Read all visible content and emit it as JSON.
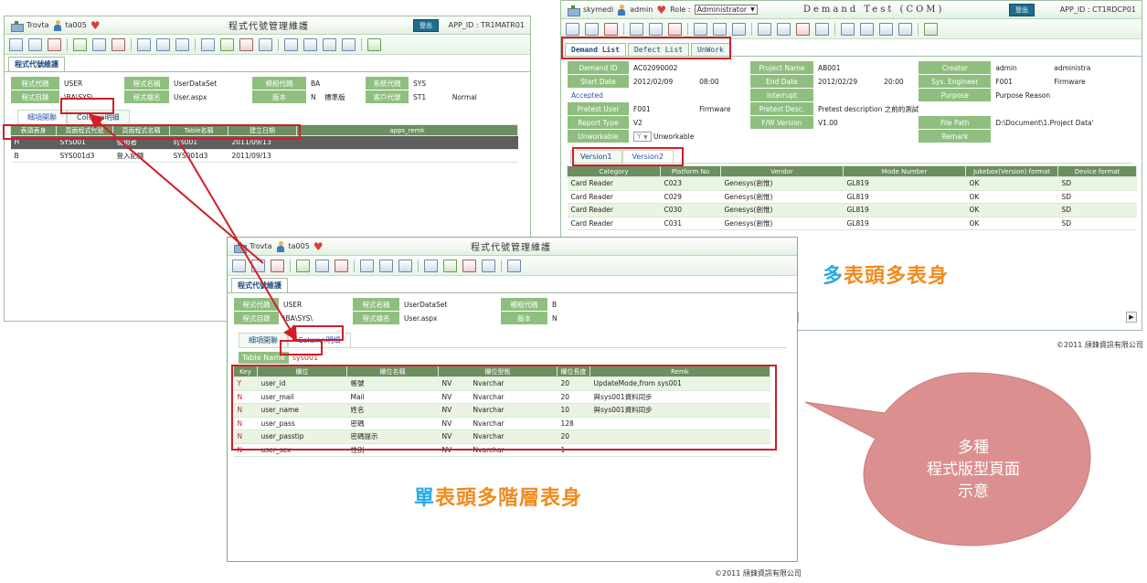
{
  "left_win": {
    "user": "Trovta",
    "user2": "ta005",
    "title": "程式代號管理維護",
    "logout_label": "登出",
    "app_id": "APP_ID : TR1MATR01",
    "tab_label": "程式代號維護",
    "form": {
      "row1": [
        "程式代碼",
        "USER",
        "程式名稱",
        "UserDataSet",
        "模組代碼",
        "BA",
        "系統代碼",
        "SYS"
      ],
      "row2": [
        "程式目錄",
        "\\BA\\SYS\\",
        "程式檔名",
        "User.aspx",
        "版本",
        "N",
        "標準版",
        "客戶代號",
        "ST1",
        "Normal"
      ]
    },
    "subtabs": [
      "細項開聯",
      "Column明細"
    ],
    "grid_headers": [
      "表頭表身",
      "頁面程式代號",
      "頁面程式名稱",
      "Table名稱",
      "建立日期",
      "apps_remk"
    ],
    "grid_rows": [
      [
        "H",
        "SYS001",
        "使用者",
        "sys001",
        "2011/09/13",
        ""
      ],
      [
        "B",
        "SYS001d3",
        "登入記錄",
        "SYS001d3",
        "2011/09/13",
        ""
      ]
    ]
  },
  "right_win": {
    "user": "skymedi",
    "user2": "admin",
    "role_label": "Role :",
    "role_value": "Administrator",
    "title": "Demand Test (COM)",
    "logout_label": "登出",
    "app_id": "APP_ID : CT1RDCP01",
    "tabs": [
      "Demand List",
      "Defect List",
      "UnWork"
    ],
    "form": {
      "r1": [
        "Demand ID",
        "AC02090002",
        "Project Name",
        "AB001",
        "Creator",
        "admin",
        "administra"
      ],
      "r2": [
        "Start Date",
        "2012/02/09",
        "08:00",
        "End Date",
        "2012/02/29",
        "20:00",
        "Sys. Engineer",
        "F001",
        "Firmware"
      ],
      "r3": [
        "Accepted",
        "Interrupt",
        "Purpose",
        "Purpose Reason"
      ],
      "r4": [
        "Pretest User",
        "F001",
        "Firmware",
        "Pretest Desc.",
        "Pretest description 之前的測試"
      ],
      "r5": [
        "Report Type",
        "V2",
        "F/W Version",
        "V1.00",
        "File Path",
        "D:\\Document\\1.Project Data'"
      ],
      "r6": [
        "Unworkable",
        "Y",
        "Unworkable",
        "Remark"
      ]
    },
    "version_tabs": [
      "Version1",
      "Version2"
    ],
    "grid_headers": [
      "Category",
      "Platform No",
      "Vendor",
      "Mode Number",
      "Jukebox(Version) format",
      "Device format"
    ],
    "grid_rows": [
      [
        "Card Reader",
        "C023",
        "Genesys(創惟)",
        "GL819",
        "OK",
        "SD"
      ],
      [
        "Card Reader",
        "C029",
        "Genesys(創惟)",
        "GL819",
        "OK",
        "SD"
      ],
      [
        "Card Reader",
        "C030",
        "Genesys(創惟)",
        "GL819",
        "OK",
        "SD"
      ],
      [
        "Card Reader",
        "C031",
        "Genesys(創惟)",
        "GL819",
        "OK",
        "SD"
      ]
    ],
    "caption": "多表頭多表身",
    "copyright": "©2011 頎鋒資訊有限公司"
  },
  "front_win": {
    "user": "Trovta",
    "user2": "ta005",
    "title": "程式代號管理維護",
    "tab_label": "程式代號維護",
    "form": {
      "row1": [
        "程式代碼",
        "USER",
        "程式名稱",
        "UserDataSet",
        "模組代碼",
        "B"
      ],
      "row2": [
        "程式目錄",
        "\\BA\\SYS\\",
        "程式檔名",
        "User.aspx",
        "版本",
        "N"
      ]
    },
    "subtabs": [
      "細項開聯",
      "Column明細"
    ],
    "table_name_label": "Table Name",
    "table_name_value": "sys001",
    "grid_headers": [
      "Key",
      "欄位",
      "欄位名稱",
      "欄位型態",
      "欄位長度",
      "Remk"
    ],
    "grid_rows": [
      [
        "Y",
        "user_id",
        "帳號",
        "NV",
        "Nvarchar",
        "20",
        "UpdateMode,from sys001"
      ],
      [
        "N",
        "user_mail",
        "Mail",
        "NV",
        "Nvarchar",
        "20",
        "與sys001資料同步"
      ],
      [
        "N",
        "user_name",
        "姓名",
        "NV",
        "Nvarchar",
        "10",
        "與sys001資料同步"
      ],
      [
        "N",
        "user_pass",
        "密碼",
        "NV",
        "Nvarchar",
        "128",
        ""
      ],
      [
        "N",
        "user_passtip",
        "密碼提示",
        "NV",
        "Nvarchar",
        "20",
        ""
      ],
      [
        "N",
        "user_sex",
        "性別",
        "NV",
        "Nvarchar",
        "1",
        ""
      ]
    ],
    "caption_1": "單",
    "caption_2": "表頭多階層表身",
    "copyright": "©2011 頎鋒資訊有限公司"
  },
  "callout": {
    "line1": "多種",
    "line2": "程式版型頁面",
    "line3": "示意"
  },
  "colors": {
    "accent_green": "#8fbf7f",
    "header_green": "#6b8f5f",
    "highlight_red": "#d11e2a",
    "caption_blue": "#29a9e0",
    "caption_orange": "#f08a1e",
    "bubble": "#dc8f8f"
  }
}
